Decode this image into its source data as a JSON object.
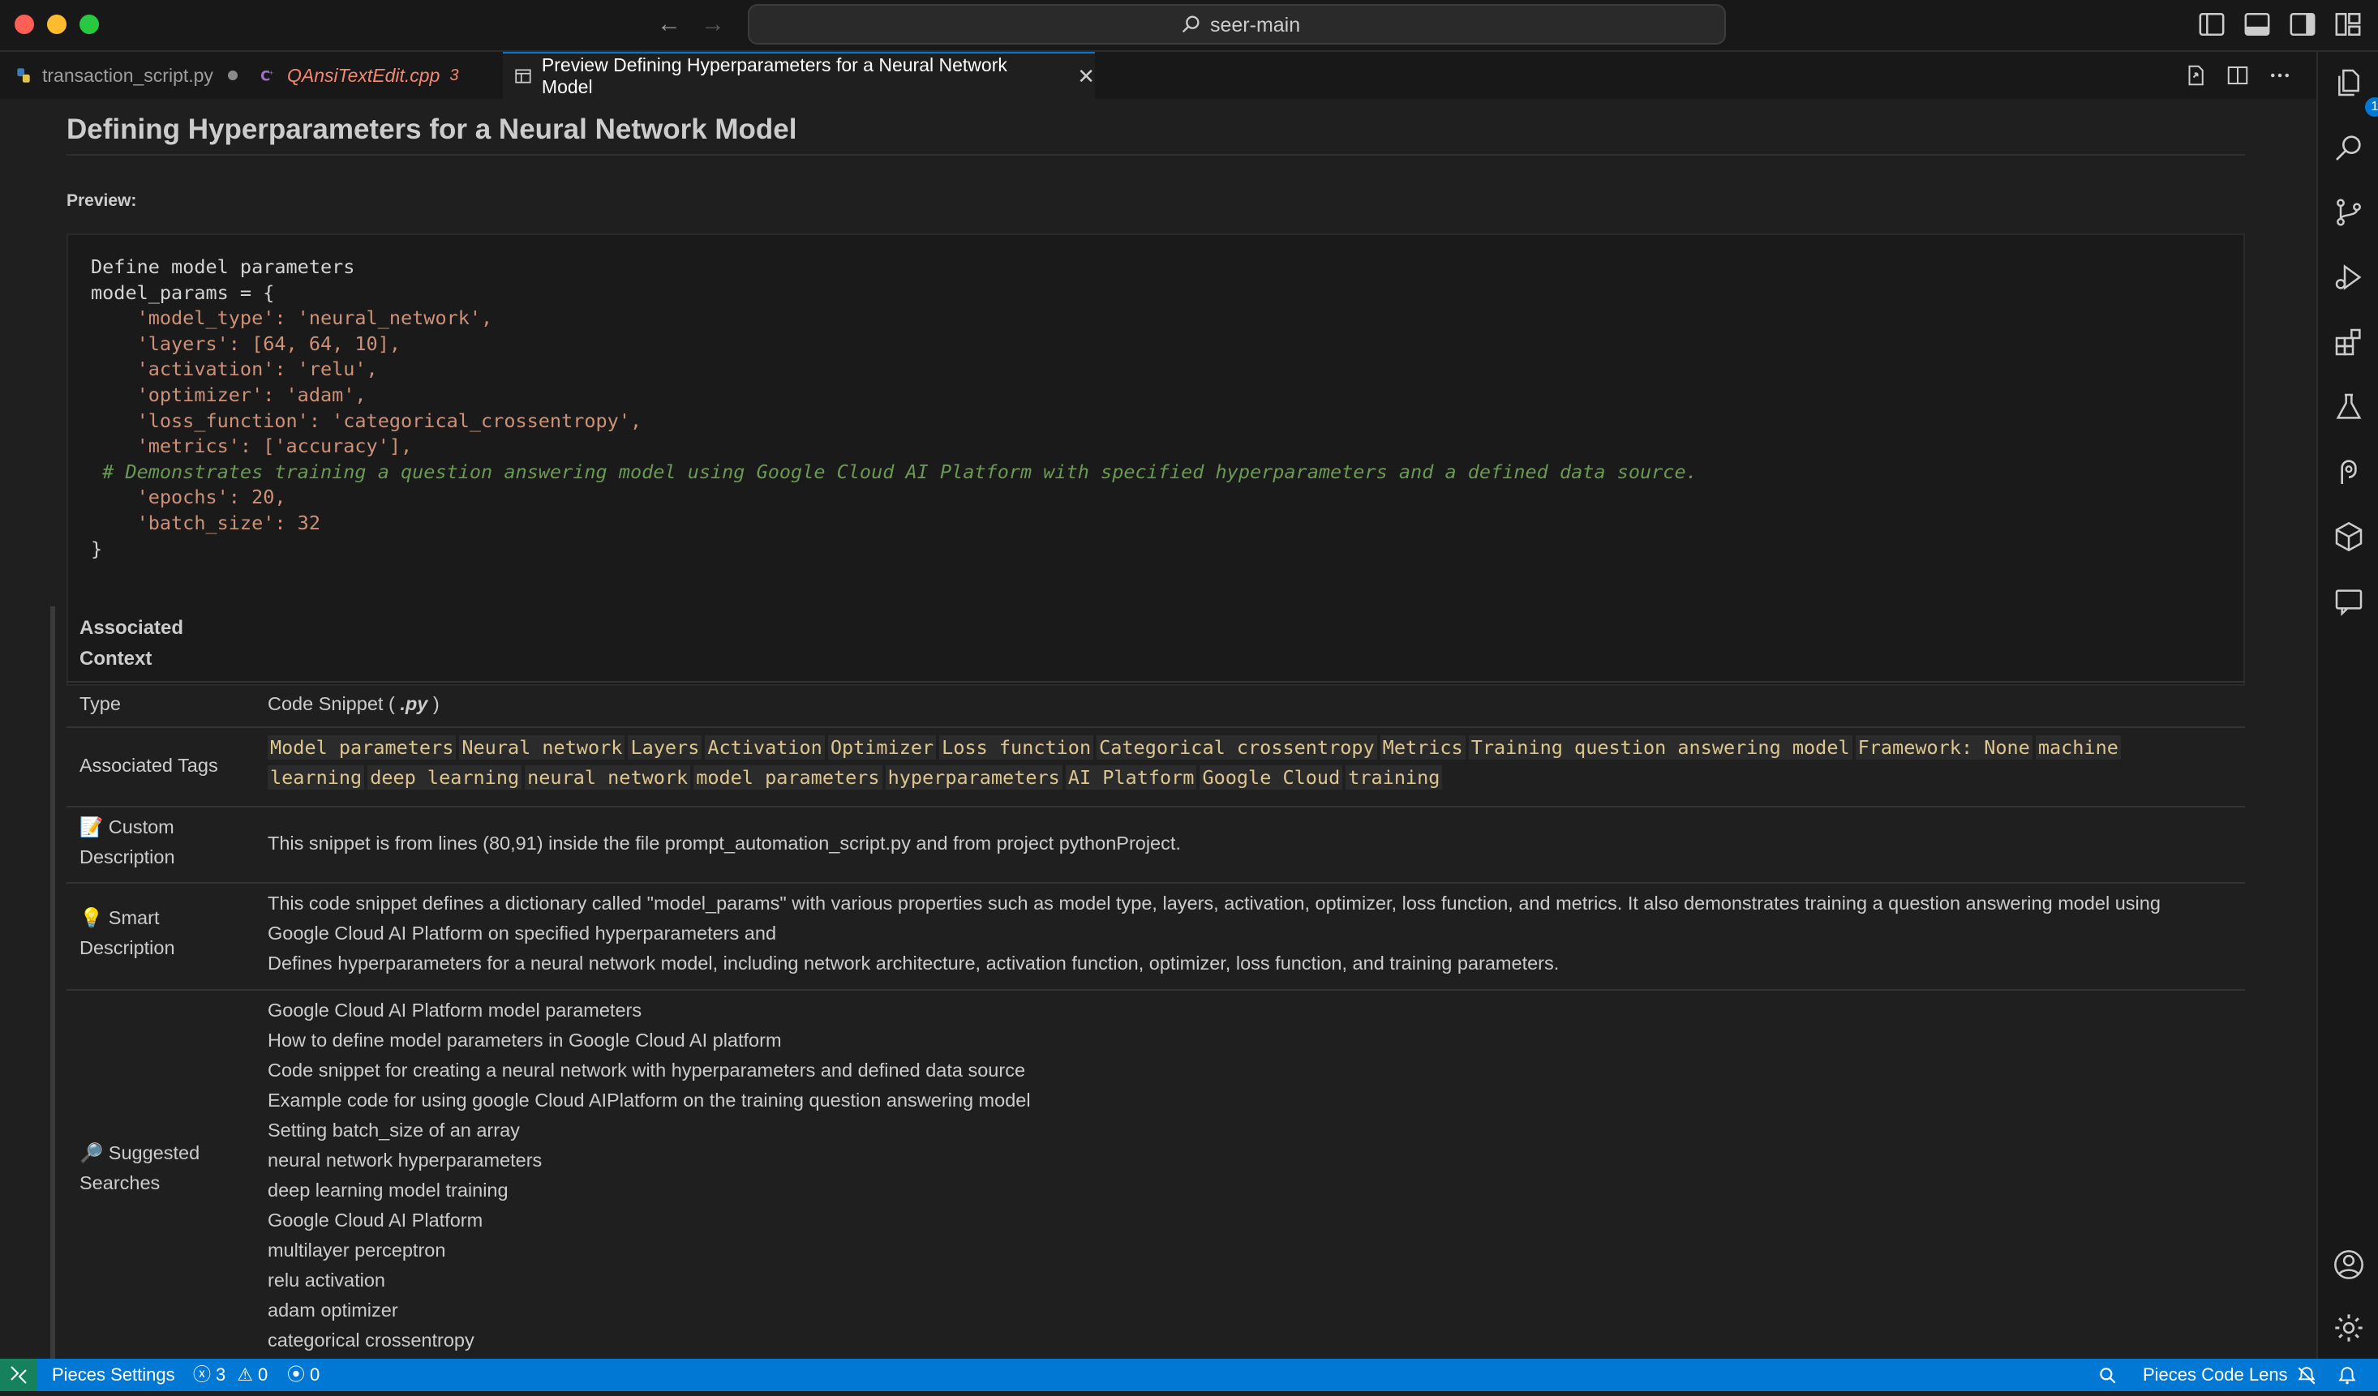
{
  "window": {
    "search_text": "seer-main"
  },
  "tabs": [
    {
      "label": "transaction_script.py"
    },
    {
      "label": "QAnsiTextEdit.cpp",
      "problems": "3"
    },
    {
      "label": "Preview Defining Hyperparameters for a Neural Network Model"
    }
  ],
  "page": {
    "title": "Defining Hyperparameters for a Neural Network Model",
    "preview_label": "Preview:",
    "code_lines": [
      "Define model parameters",
      "model_params = {",
      "    'model_type': 'neural_network',",
      "    'layers': [64, 64, 10],",
      "    'activation': 'relu',",
      "    'optimizer': 'adam',",
      "    'loss_function': 'categorical_crossentropy',",
      "    'metrics': ['accuracy'],",
      " # Demonstrates training a question answering model using Google Cloud AI Platform with specified hyperparameters and a defined data source.",
      "    'epochs': 20,",
      "    'batch_size': 32",
      "}"
    ]
  },
  "context": {
    "heading_line1": "Associated",
    "heading_line2": "Context",
    "type_label": "Type",
    "type_value_prefix": "Code Snippet (",
    "type_value_ext": ".py",
    "type_value_suffix": ")",
    "tags_label": "Associated Tags",
    "tags": [
      "Model parameters",
      "Neural network",
      "Layers",
      "Activation",
      "Optimizer",
      "Loss function",
      "Categorical crossentropy",
      "Metrics",
      "Training question answering model",
      "Framework: None",
      "machine",
      "learning",
      "deep learning",
      "neural network",
      "model parameters",
      "hyperparameters",
      "AI Platform",
      "Google Cloud",
      "training"
    ],
    "custom_emoji": "📝",
    "custom_label_1": "Custom",
    "custom_label_2": "Description",
    "custom_value": "This snippet is from lines (80,91) inside the file prompt_automation_script.py and from project pythonProject.",
    "smart_emoji": "💡",
    "smart_label_1": "Smart",
    "smart_label_2": "Description",
    "smart_lines": [
      "This code snippet defines a dictionary called \"model_params\" with various properties such as model type, layers, activation, optimizer, loss function, and metrics. It also demonstrates training a question answering model using",
      "Google Cloud AI Platform on specified hyperparameters and",
      "Defines hyperparameters for a neural network model, including network architecture, activation function, optimizer, loss function, and training parameters."
    ],
    "search_emoji": "🔎",
    "search_label_1": "Suggested",
    "search_label_2": "Searches",
    "searches": [
      "Google Cloud AI Platform model parameters",
      "How to define model parameters in Google Cloud AI platform",
      "Code snippet for creating a neural network with hyperparameters and defined data source",
      "Example code for using google Cloud AIPlatform on the training question answering model",
      "Setting batch_size of an array",
      "neural network hyperparameters",
      "deep learning model training",
      "Google Cloud AI Platform",
      "multilayer perceptron",
      "relu activation",
      "adam optimizer",
      "categorical crossentropy"
    ]
  },
  "activity": {
    "explorer_badge": "1"
  },
  "status": {
    "pieces_settings": "Pieces Settings",
    "errors": "3",
    "warnings": "0",
    "ports": "0",
    "code_lens": "Pieces Code Lens"
  },
  "colors": {
    "accent": "#0078d4",
    "statusbar": "#0078d4",
    "remote": "#16825d",
    "tab_problem": "#f48771"
  }
}
